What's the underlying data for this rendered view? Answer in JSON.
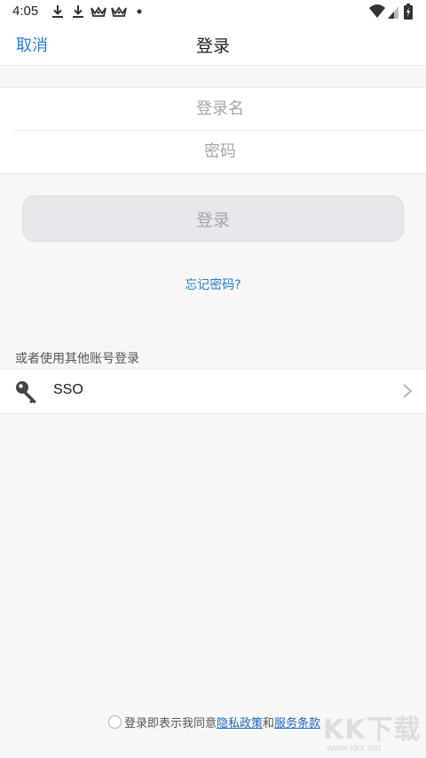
{
  "status_bar": {
    "time": "4:05",
    "notification_icons": [
      "download-icon",
      "download-icon",
      "app-crown-icon",
      "app-crown-icon",
      "dot-icon"
    ],
    "system_icons": [
      "wifi-icon",
      "signal-icon",
      "battery-charging-icon"
    ]
  },
  "nav": {
    "cancel_label": "取消",
    "title": "登录"
  },
  "form": {
    "login_name_placeholder": "登录名",
    "password_placeholder": "密码"
  },
  "login_button_label": "登录",
  "forgot_password_label": "忘记密码?",
  "other_login": {
    "section_label": "或者使用其他账号登录",
    "items": [
      {
        "label": "SSO",
        "icon": "key-icon"
      }
    ]
  },
  "agreement": {
    "prefix": "登录即表示我同意",
    "privacy_link": "隐私政策",
    "conjunction": "和",
    "terms_link": "服务条款"
  },
  "watermark": {
    "text": "KK下载",
    "url": "www.kkx.net"
  },
  "colors": {
    "accent": "#2b7cd3",
    "link": "#1f66c1",
    "background": "#f7f7f8",
    "button_disabled_bg": "#e8e8ec",
    "button_disabled_text": "#a5a5aa"
  }
}
